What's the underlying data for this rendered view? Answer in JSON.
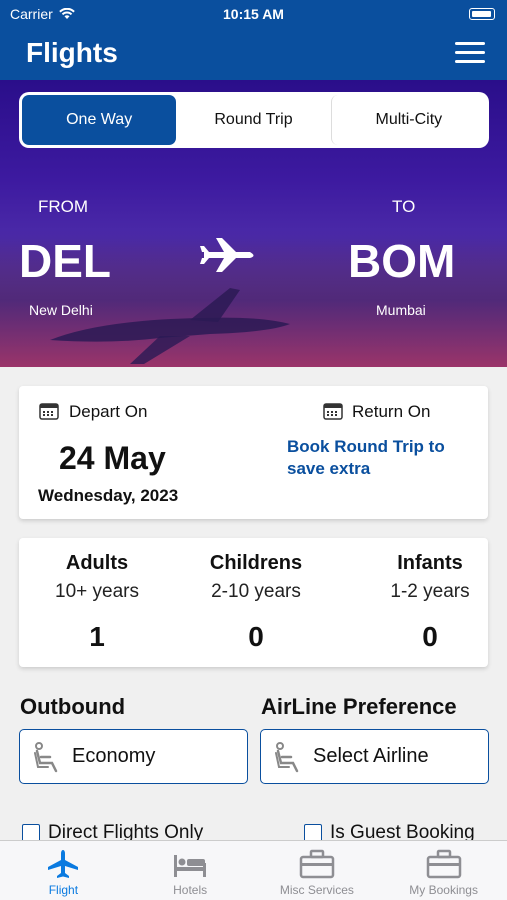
{
  "status_bar": {
    "carrier": "Carrier",
    "time": "10:15 AM"
  },
  "header": {
    "title": "Flights"
  },
  "trip_type": {
    "tabs": [
      {
        "label": "One Way",
        "active": true
      },
      {
        "label": "Round Trip",
        "active": false
      },
      {
        "label": "Multi-City",
        "active": false
      }
    ]
  },
  "route": {
    "from_label": "FROM",
    "from_code": "DEL",
    "from_city": "New Delhi",
    "to_label": "TO",
    "to_code": "BOM",
    "to_city": "Mumbai"
  },
  "dates": {
    "depart_label": "Depart On",
    "depart_date": "24 May",
    "depart_weekday": "Wednesday, 2023",
    "return_label": "Return On",
    "return_hint": "Book Round Trip to save extra"
  },
  "passengers": [
    {
      "title": "Adults",
      "age": "10+ years",
      "count": "1"
    },
    {
      "title": "Childrens",
      "age": "2-10 years",
      "count": "0"
    },
    {
      "title": "Infants",
      "age": "1-2 years",
      "count": "0"
    }
  ],
  "outbound": {
    "title": "Outbound",
    "value": "Economy"
  },
  "airline": {
    "title": "AirLine Preference",
    "value": "Select Airline"
  },
  "options": {
    "direct_flights": "Direct Flights Only",
    "guest_booking": "Is Guest Booking"
  },
  "tab_bar": {
    "items": [
      {
        "label": "Flight",
        "icon": "airplane-icon",
        "active": true
      },
      {
        "label": "Hotels",
        "icon": "bed-icon",
        "active": false
      },
      {
        "label": "Misc Services",
        "icon": "briefcase-icon",
        "active": false
      },
      {
        "label": "My Bookings",
        "icon": "briefcase-icon",
        "active": false
      }
    ]
  },
  "colors": {
    "primary": "#0a4f9e",
    "tab_active": "#0a7ae0",
    "tab_inactive": "#8e8e93"
  }
}
